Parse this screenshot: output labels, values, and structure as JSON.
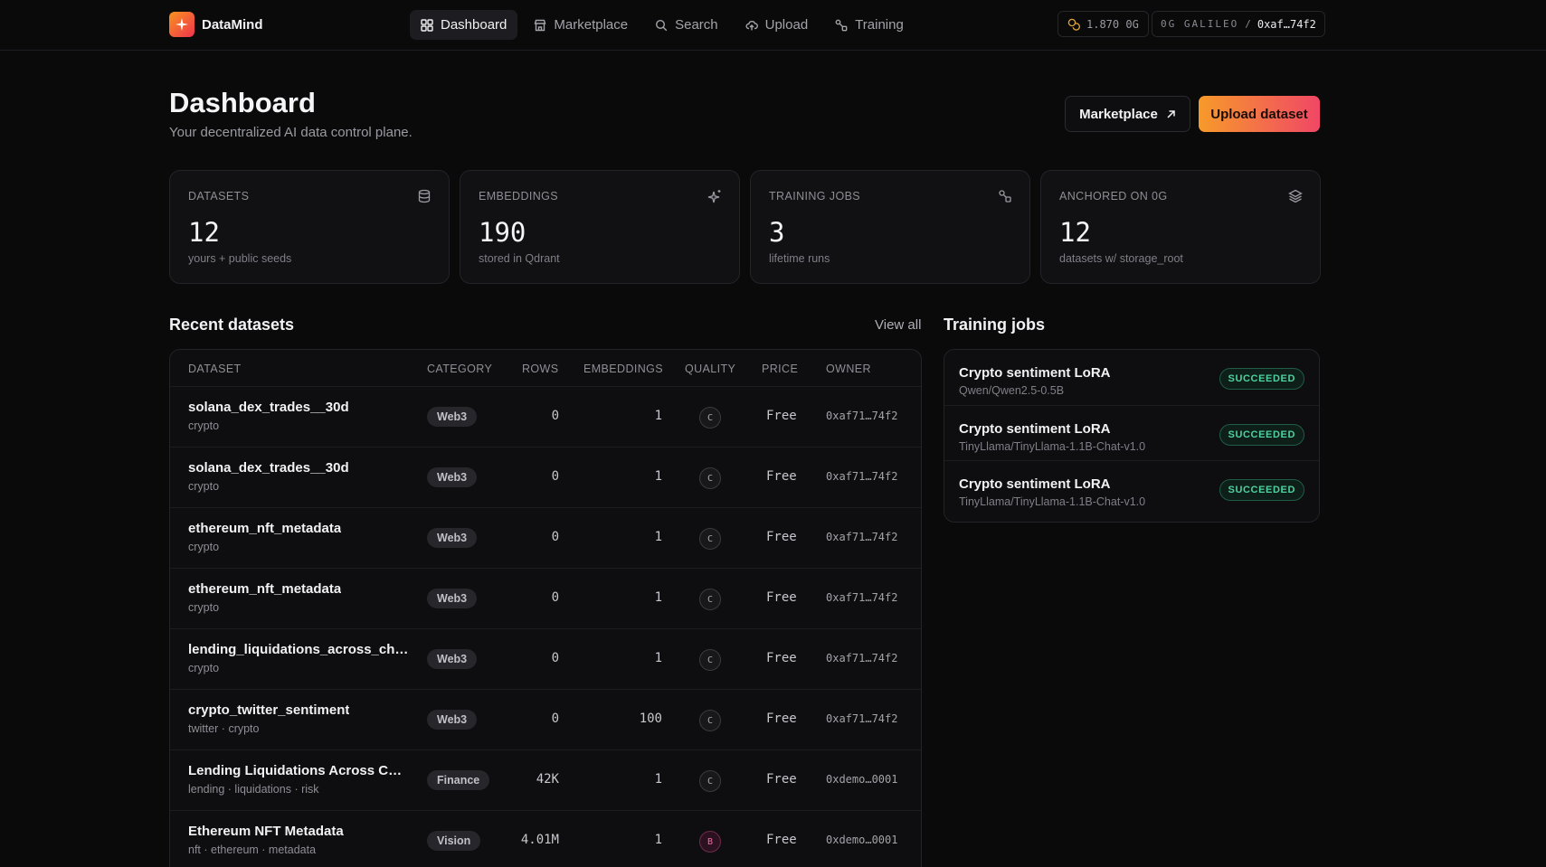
{
  "app": {
    "name": "DataMind"
  },
  "nav": [
    {
      "label": "Dashboard",
      "icon": "grid-icon",
      "active": true
    },
    {
      "label": "Marketplace",
      "icon": "store-icon"
    },
    {
      "label": "Search",
      "icon": "search-icon"
    },
    {
      "label": "Upload",
      "icon": "upload-cloud-icon"
    },
    {
      "label": "Training",
      "icon": "workflow-icon"
    }
  ],
  "wallet": {
    "balance": "1.870 0G",
    "network": "0G GALILEO",
    "separator": "/",
    "address": "0xaf…74f2"
  },
  "header": {
    "title": "Dashboard",
    "subtitle": "Your decentralized AI data control plane.",
    "marketplace_label": "Marketplace",
    "upload_label": "Upload dataset"
  },
  "stats": [
    {
      "label": "DATASETS",
      "value": "12",
      "sub": "yours + public seeds",
      "icon": "database-icon"
    },
    {
      "label": "EMBEDDINGS",
      "value": "190",
      "sub": "stored in Qdrant",
      "icon": "sparkles-icon"
    },
    {
      "label": "TRAINING JOBS",
      "value": "3",
      "sub": "lifetime runs",
      "icon": "workflow-icon"
    },
    {
      "label": "ANCHORED ON 0G",
      "value": "12",
      "sub": "datasets w/ storage_root",
      "icon": "layers-icon"
    }
  ],
  "recent": {
    "title": "Recent datasets",
    "view_all": "View all",
    "columns": [
      "DATASET",
      "CATEGORY",
      "ROWS",
      "EMBEDDINGS",
      "QUALITY",
      "PRICE",
      "OWNER"
    ],
    "rows": [
      {
        "name": "solana_dex_trades__30d",
        "tags": "crypto",
        "category": "Web3",
        "rows": "0",
        "embeddings": "1",
        "quality": "C",
        "price": "Free",
        "owner": "0xaf71…74f2"
      },
      {
        "name": "solana_dex_trades__30d",
        "tags": "crypto",
        "category": "Web3",
        "rows": "0",
        "embeddings": "1",
        "quality": "C",
        "price": "Free",
        "owner": "0xaf71…74f2"
      },
      {
        "name": "ethereum_nft_metadata",
        "tags": "crypto",
        "category": "Web3",
        "rows": "0",
        "embeddings": "1",
        "quality": "C",
        "price": "Free",
        "owner": "0xaf71…74f2"
      },
      {
        "name": "ethereum_nft_metadata",
        "tags": "crypto",
        "category": "Web3",
        "rows": "0",
        "embeddings": "1",
        "quality": "C",
        "price": "Free",
        "owner": "0xaf71…74f2"
      },
      {
        "name": "lending_liquidations_across_chai...",
        "tags": "crypto",
        "category": "Web3",
        "rows": "0",
        "embeddings": "1",
        "quality": "C",
        "price": "Free",
        "owner": "0xaf71…74f2"
      },
      {
        "name": "crypto_twitter_sentiment",
        "tags": "twitter · crypto",
        "category": "Web3",
        "rows": "0",
        "embeddings": "100",
        "quality": "C",
        "price": "Free",
        "owner": "0xaf71…74f2"
      },
      {
        "name": "Lending Liquidations Across Cha...",
        "tags": "lending · liquidations · risk",
        "category": "Finance",
        "rows": "42K",
        "embeddings": "1",
        "quality": "C",
        "price": "Free",
        "owner": "0xdemo…0001"
      },
      {
        "name": "Ethereum NFT Metadata",
        "tags": "nft · ethereum · metadata",
        "category": "Vision",
        "rows": "4.01M",
        "embeddings": "1",
        "quality": "B",
        "price": "Free",
        "owner": "0xdemo…0001"
      }
    ]
  },
  "training": {
    "title": "Training jobs",
    "jobs": [
      {
        "name": "Crypto sentiment LoRA",
        "model": "Qwen/Qwen2.5-0.5B",
        "status": "SUCCEEDED"
      },
      {
        "name": "Crypto sentiment LoRA",
        "model": "TinyLlama/TinyLlama-1.1B-Chat-v1.0",
        "status": "SUCCEEDED"
      },
      {
        "name": "Crypto sentiment LoRA",
        "model": "TinyLlama/TinyLlama-1.1B-Chat-v1.0",
        "status": "SUCCEEDED"
      }
    ]
  }
}
